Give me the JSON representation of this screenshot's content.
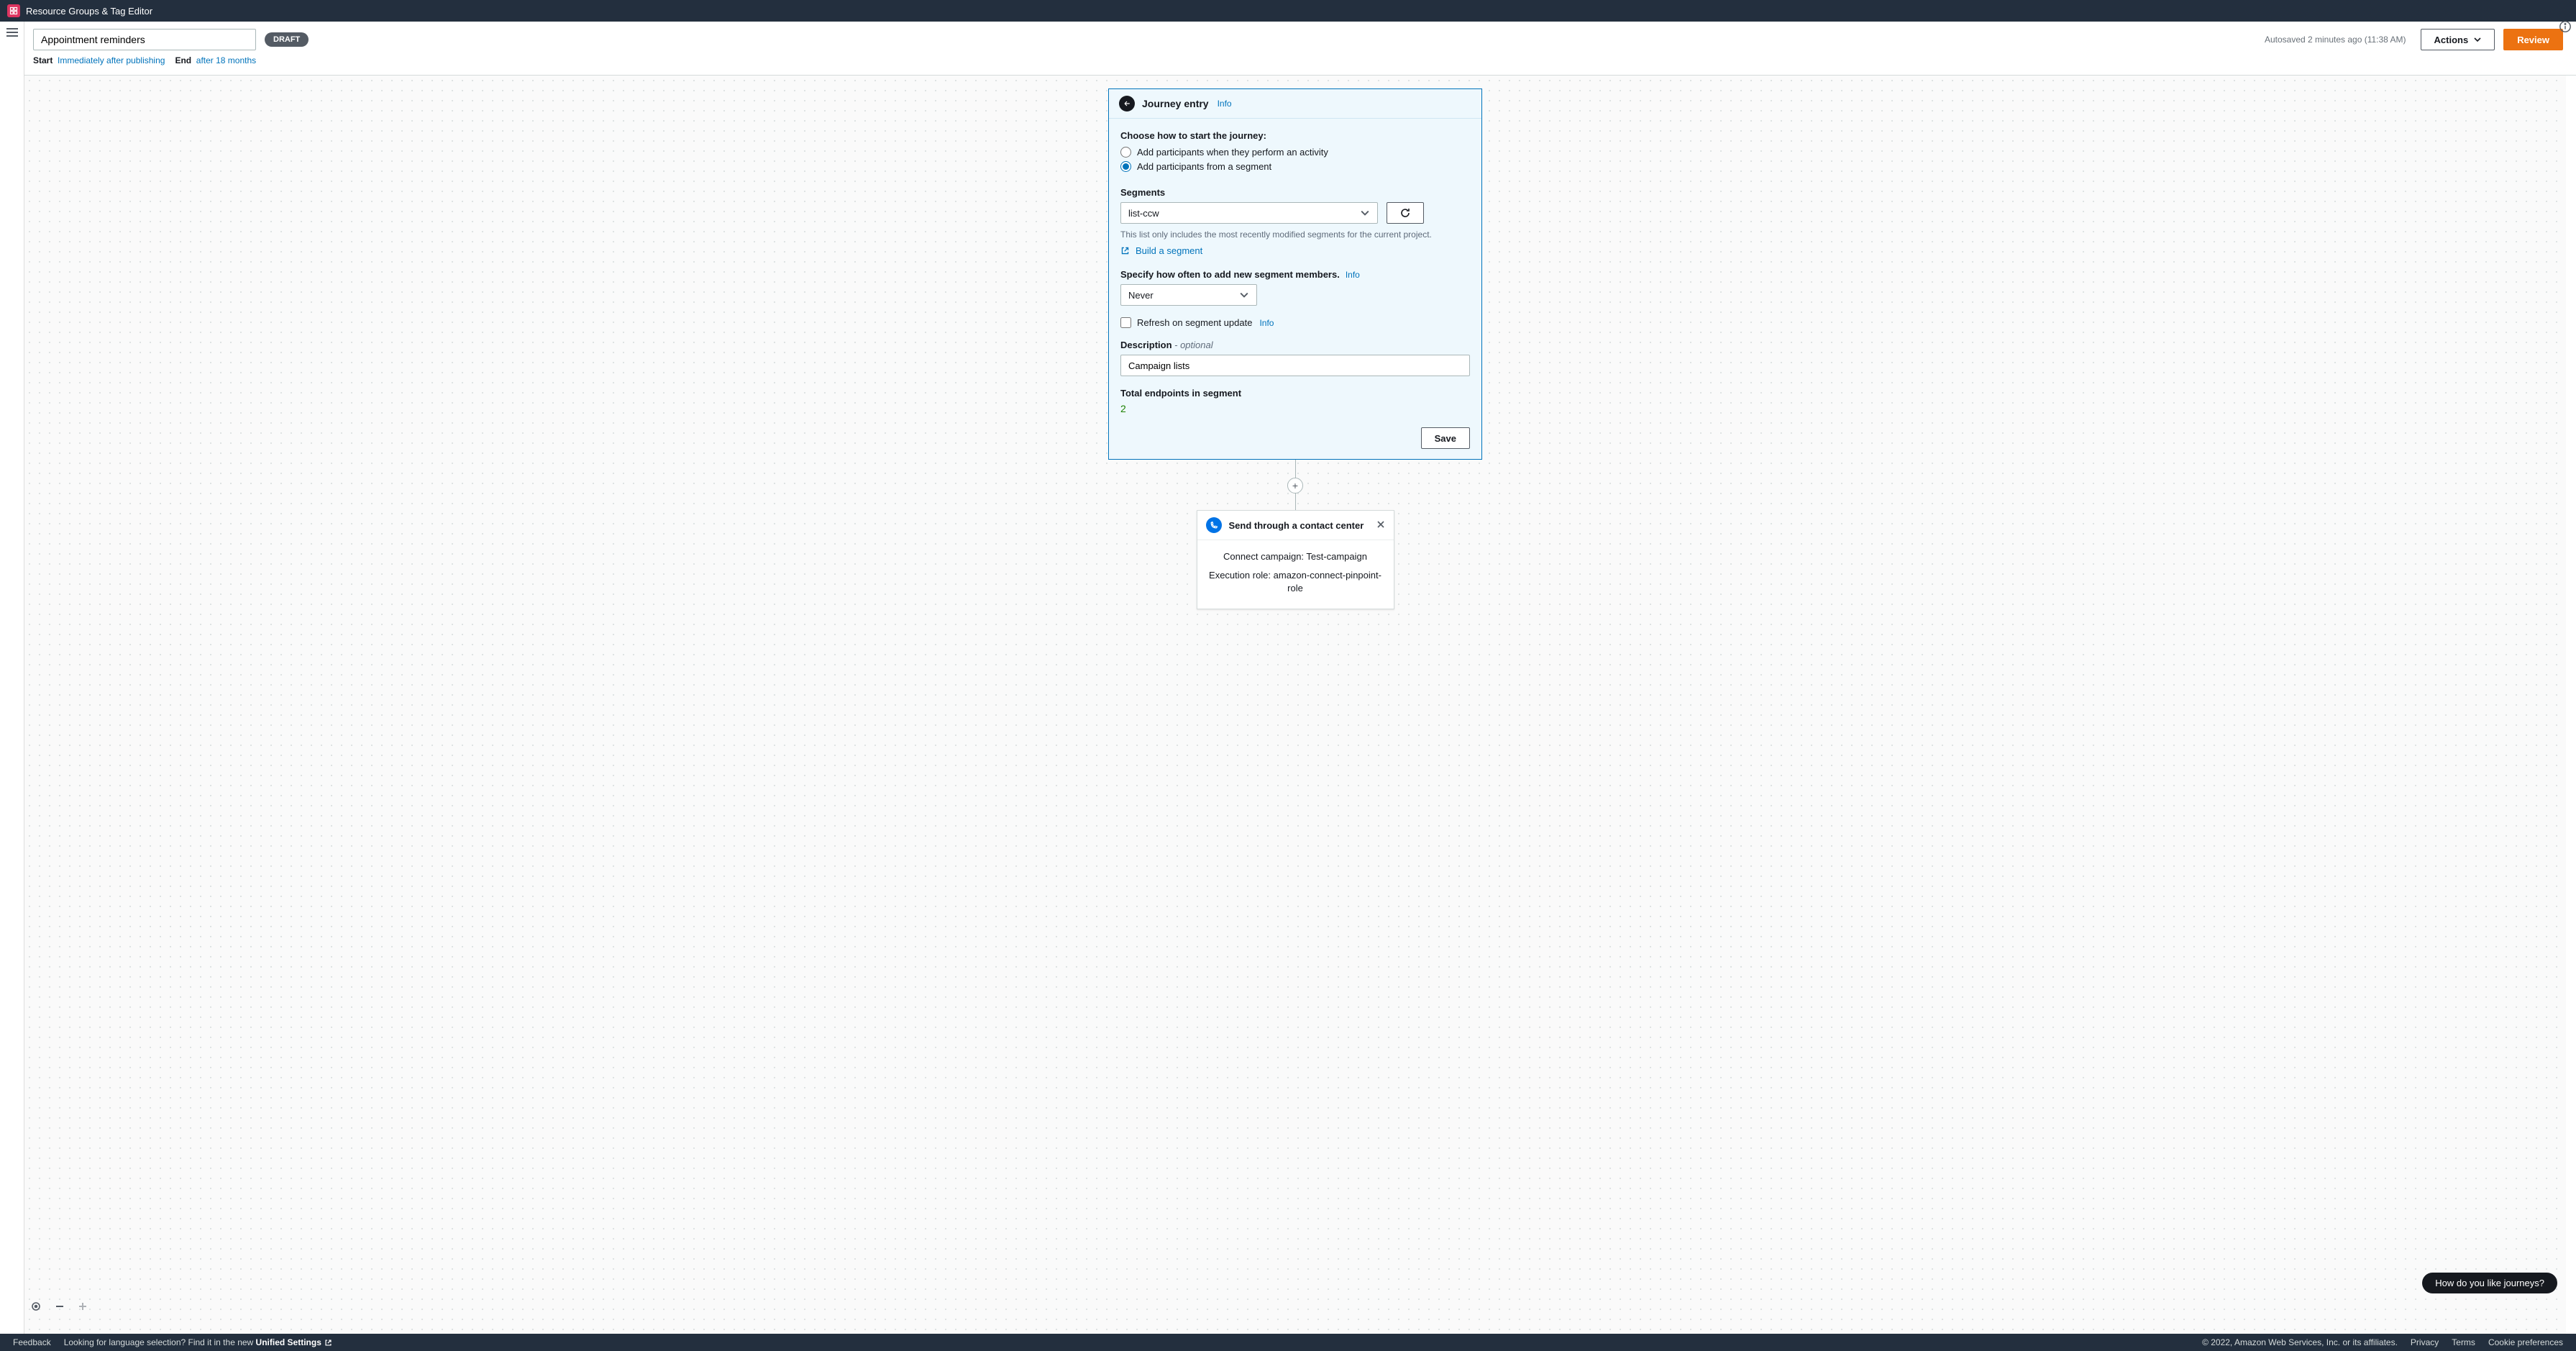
{
  "serviceBar": {
    "title": "Resource Groups & Tag Editor"
  },
  "header": {
    "journeyName": "Appointment reminders",
    "badge": "DRAFT",
    "autosave": "Autosaved 2 minutes ago (11:38 AM)",
    "actionsLabel": "Actions",
    "reviewLabel": "Review"
  },
  "subheader": {
    "startLabel": "Start",
    "startValue": "Immediately after publishing",
    "endLabel": "End",
    "endValue": "after 18 months"
  },
  "journeyEntry": {
    "title": "Journey entry",
    "infoLabel": "Info",
    "choosePrompt": "Choose how to start the journey:",
    "optionActivity": "Add participants when they perform an activity",
    "optionSegment": "Add participants from a segment",
    "segmentsLabel": "Segments",
    "segmentSelected": "list-ccw",
    "segmentListHint": "This list only includes the most recently modified segments for the current project.",
    "buildSegmentLink": "Build a segment",
    "addFrequencyLabel": "Specify how often to add new segment members.",
    "addFrequencySelected": "Never",
    "refreshCheckbox": "Refresh on segment update",
    "descriptionLabel": "Description",
    "descriptionOptional": " - optional",
    "descriptionValue": "Campaign lists",
    "totalEndpointsLabel": "Total endpoints in segment",
    "totalEndpointsValue": "2",
    "saveLabel": "Save"
  },
  "contactCenter": {
    "title": "Send through a contact center",
    "campaignLine": "Connect campaign: Test-campaign",
    "roleLine": "Execution role: amazon-connect-pinpoint-role"
  },
  "feedbackPill": "How do you like journeys?",
  "footer": {
    "feedback": "Feedback",
    "langPrompt": "Looking for language selection? Find it in the new ",
    "unifiedSettings": "Unified Settings",
    "copyright": "© 2022, Amazon Web Services, Inc. or its affiliates.",
    "privacy": "Privacy",
    "terms": "Terms",
    "cookies": "Cookie preferences"
  }
}
